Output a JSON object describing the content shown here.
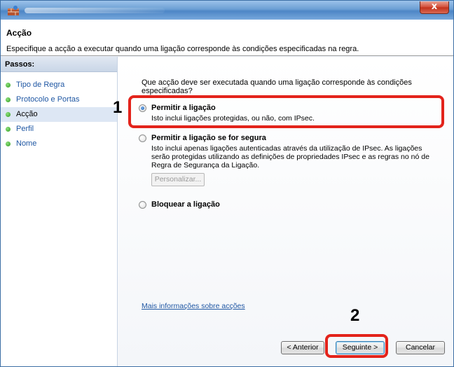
{
  "header": {
    "title": "Acção",
    "description": "Especifique a acção a executar quando uma ligação corresponde às condições especificadas na regra."
  },
  "sidebar": {
    "title": "Passos:",
    "steps": [
      {
        "label": "Tipo de Regra",
        "current": false
      },
      {
        "label": "Protocolo e Portas",
        "current": false
      },
      {
        "label": "Acção",
        "current": true
      },
      {
        "label": "Perfil",
        "current": false
      },
      {
        "label": "Nome",
        "current": false
      }
    ]
  },
  "main": {
    "question": "Que acção deve ser executada quando uma ligação corresponde às condições especificadas?",
    "options": [
      {
        "label": "Permitir a ligação",
        "description": "Isto inclui ligações protegidas, ou não, com IPsec.",
        "selected": true
      },
      {
        "label": "Permitir a ligação se for segura",
        "description": "Isto inclui apenas ligações autenticadas através da utilização de IPsec. As ligações serão protegidas utilizando as definições de propriedades IPsec e as regras no nó de Regra de Segurança da Ligação.",
        "selected": false
      },
      {
        "label": "Bloquear a ligação",
        "description": "",
        "selected": false
      }
    ],
    "customize_label": "Personalizar...",
    "more_info_link": "Mais informações sobre acções"
  },
  "buttons": {
    "back": "< Anterior",
    "next": "Seguinte >",
    "cancel": "Cancelar"
  },
  "titlebar": {
    "close_glyph": "x"
  },
  "callouts": {
    "one": "1",
    "two": "2"
  },
  "colors": {
    "highlight": "#e3231b",
    "link": "#1f57a3"
  }
}
